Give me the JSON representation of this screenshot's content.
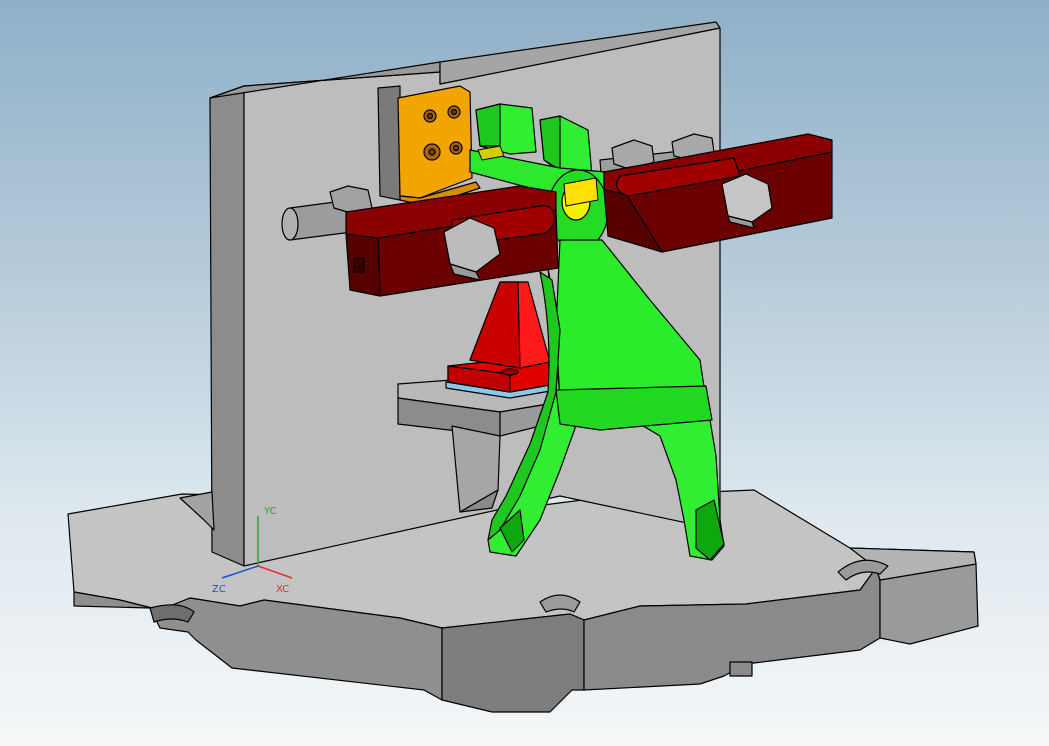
{
  "viewport": {
    "colors": {
      "background_top": "#8fb0c8",
      "background_bottom": "#f5f7f8",
      "fixture_gray": "#a9a9a9",
      "workpiece_green": "#22e622",
      "clamp_red": "#6b0000",
      "support_red": "#e00000",
      "locator_orange": "#f0a000",
      "pin_yellow": "#f4f000"
    }
  },
  "triad": {
    "yc": "YC",
    "xc": "XC",
    "zc": "ZC",
    "colors": {
      "x": "#e03030",
      "y": "#30a030",
      "z": "#2050d0"
    }
  },
  "model": {
    "parts": [
      "base-plate-icon",
      "vertical-plate-icon",
      "support-block-icon",
      "support-rib-icon",
      "red-support-icon",
      "locator-block-icon",
      "shift-fork-icon",
      "left-clamp-strap-icon",
      "right-clamp-strap-icon",
      "hex-nut-icon",
      "stud-icon",
      "pin-icon"
    ]
  }
}
